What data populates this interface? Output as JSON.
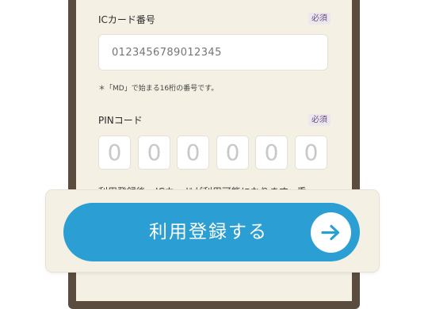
{
  "ic_card": {
    "label": "ICカード番号",
    "required": "必須",
    "placeholder": "0123456789012345",
    "note": "＊「MD」で始まる16桁の番号です。"
  },
  "pin": {
    "label": "PINコード",
    "required": "必須",
    "digits": [
      "0",
      "0",
      "0",
      "0",
      "0",
      "0"
    ]
  },
  "partial_text": "利用登録後、ICカードが利用可能になります。乗",
  "submit": {
    "label": "利用登録する",
    "icon": "arrow-right-icon"
  },
  "colors": {
    "accent": "#2b9fd3",
    "panel": "#f4f1e4",
    "frame": "#5a4c3e"
  }
}
